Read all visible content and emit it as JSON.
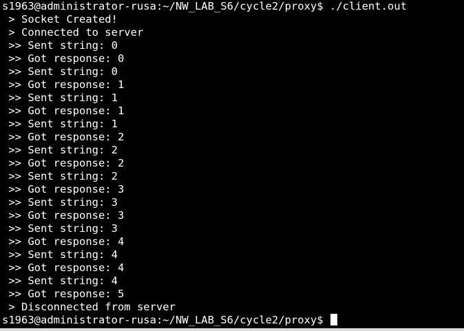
{
  "terminal": {
    "command_prompt": "s1963@administrator-rusa:~/NW_LAB_S6/cycle2/proxy$ ./client.out",
    "lines": [
      " > Socket Created!",
      " > Connected to server",
      " >> Sent string: 0",
      " >> Got response: 0",
      " >> Sent string: 0",
      " >> Got response: 1",
      " >> Sent string: 1",
      " >> Got response: 1",
      " >> Sent string: 1",
      " >> Got response: 2",
      " >> Sent string: 2",
      " >> Got response: 2",
      " >> Sent string: 2",
      " >> Got response: 3",
      " >> Sent string: 3",
      " >> Got response: 3",
      " >> Sent string: 3",
      " >> Got response: 4",
      " >> Sent string: 4",
      " >> Got response: 4",
      " >> Sent string: 4",
      " >> Got response: 5",
      " > Disconnected from server"
    ],
    "final_prompt": "s1963@administrator-rusa:~/NW_LAB_S6/cycle2/proxy$ ",
    "colors": {
      "background": "#000000",
      "foreground": "#ffffff",
      "cursor": "#ffffff"
    }
  }
}
